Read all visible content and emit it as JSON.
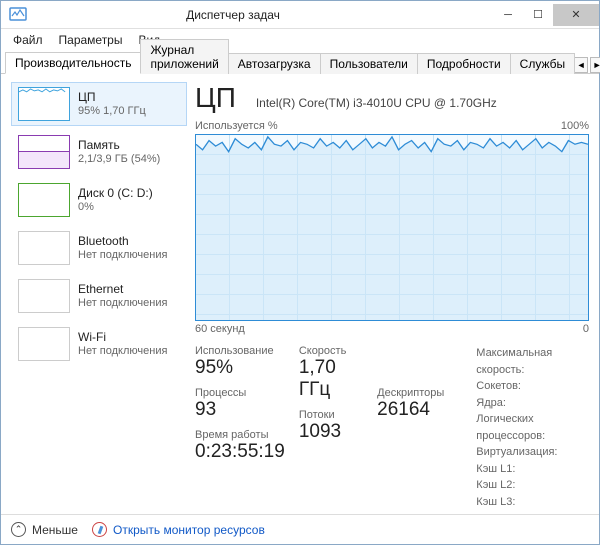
{
  "window": {
    "title": "Диспетчер задач"
  },
  "menu": {
    "file": "Файл",
    "options": "Параметры",
    "view": "Вид"
  },
  "tabs": {
    "performance": "Производительность",
    "appHistory": "Журнал приложений",
    "startup": "Автозагрузка",
    "users": "Пользователи",
    "details": "Подробности",
    "services": "Службы"
  },
  "sidebar": {
    "cpu": {
      "label": "ЦП",
      "sub": "95% 1,70 ГГц"
    },
    "memory": {
      "label": "Память",
      "sub": "2,1/3,9 ГБ (54%)"
    },
    "disk": {
      "label": "Диск 0 (C: D:)",
      "sub": "0%"
    },
    "bt": {
      "label": "Bluetooth",
      "sub": "Нет подключения"
    },
    "eth": {
      "label": "Ethernet",
      "sub": "Нет подключения"
    },
    "wifi": {
      "label": "Wi-Fi",
      "sub": "Нет подключения"
    }
  },
  "main": {
    "heading": "ЦП",
    "processor": "Intel(R) Core(TM) i3-4010U CPU @ 1.70GHz",
    "usage_label": "Используется %",
    "hundred": "100%",
    "sixty_sec": "60 секунд",
    "zero": "0",
    "stats": {
      "usage_lbl": "Использование",
      "usage_val": "95%",
      "speed_lbl": "Скорость",
      "speed_val": "1,70 ГГц",
      "proc_lbl": "Процессы",
      "proc_val": "93",
      "threads_lbl": "Потоки",
      "threads_val": "1093",
      "handles_lbl": "Дескрипторы",
      "handles_val": "26164",
      "uptime_lbl": "Время работы",
      "uptime_val": "0:23:55:19"
    },
    "info": {
      "maxspeed": "Максимальная скорость:",
      "sockets": "Сокетов:",
      "cores": "Ядра:",
      "logical": "Логических процессоров:",
      "virt": "Виртуализация:",
      "l1": "Кэш L1:",
      "l2": "Кэш L2:",
      "l3": "Кэш L3:"
    }
  },
  "footer": {
    "less": "Меньше",
    "res": "Открыть монитор ресурсов"
  },
  "chart_data": {
    "type": "line",
    "title": "Используется %",
    "xlabel": "60 секунд",
    "ylabel": "%",
    "xlim": [
      0,
      60
    ],
    "ylim": [
      0,
      100
    ],
    "series": [
      {
        "name": "CPU %",
        "color": "#2e8cd6",
        "values": [
          95,
          92,
          97,
          94,
          96,
          91,
          98,
          95,
          93,
          96,
          92,
          99,
          95,
          94,
          97,
          92,
          96,
          95,
          93,
          98,
          94,
          96,
          93,
          97,
          92,
          95,
          98,
          93,
          96,
          94,
          99,
          92,
          95,
          97,
          93,
          96,
          91,
          98,
          95,
          94,
          97,
          92,
          96,
          95,
          93,
          98,
          94,
          96,
          93,
          97,
          92,
          95,
          98,
          93,
          96,
          94,
          91,
          97,
          95,
          96,
          95
        ]
      }
    ]
  }
}
